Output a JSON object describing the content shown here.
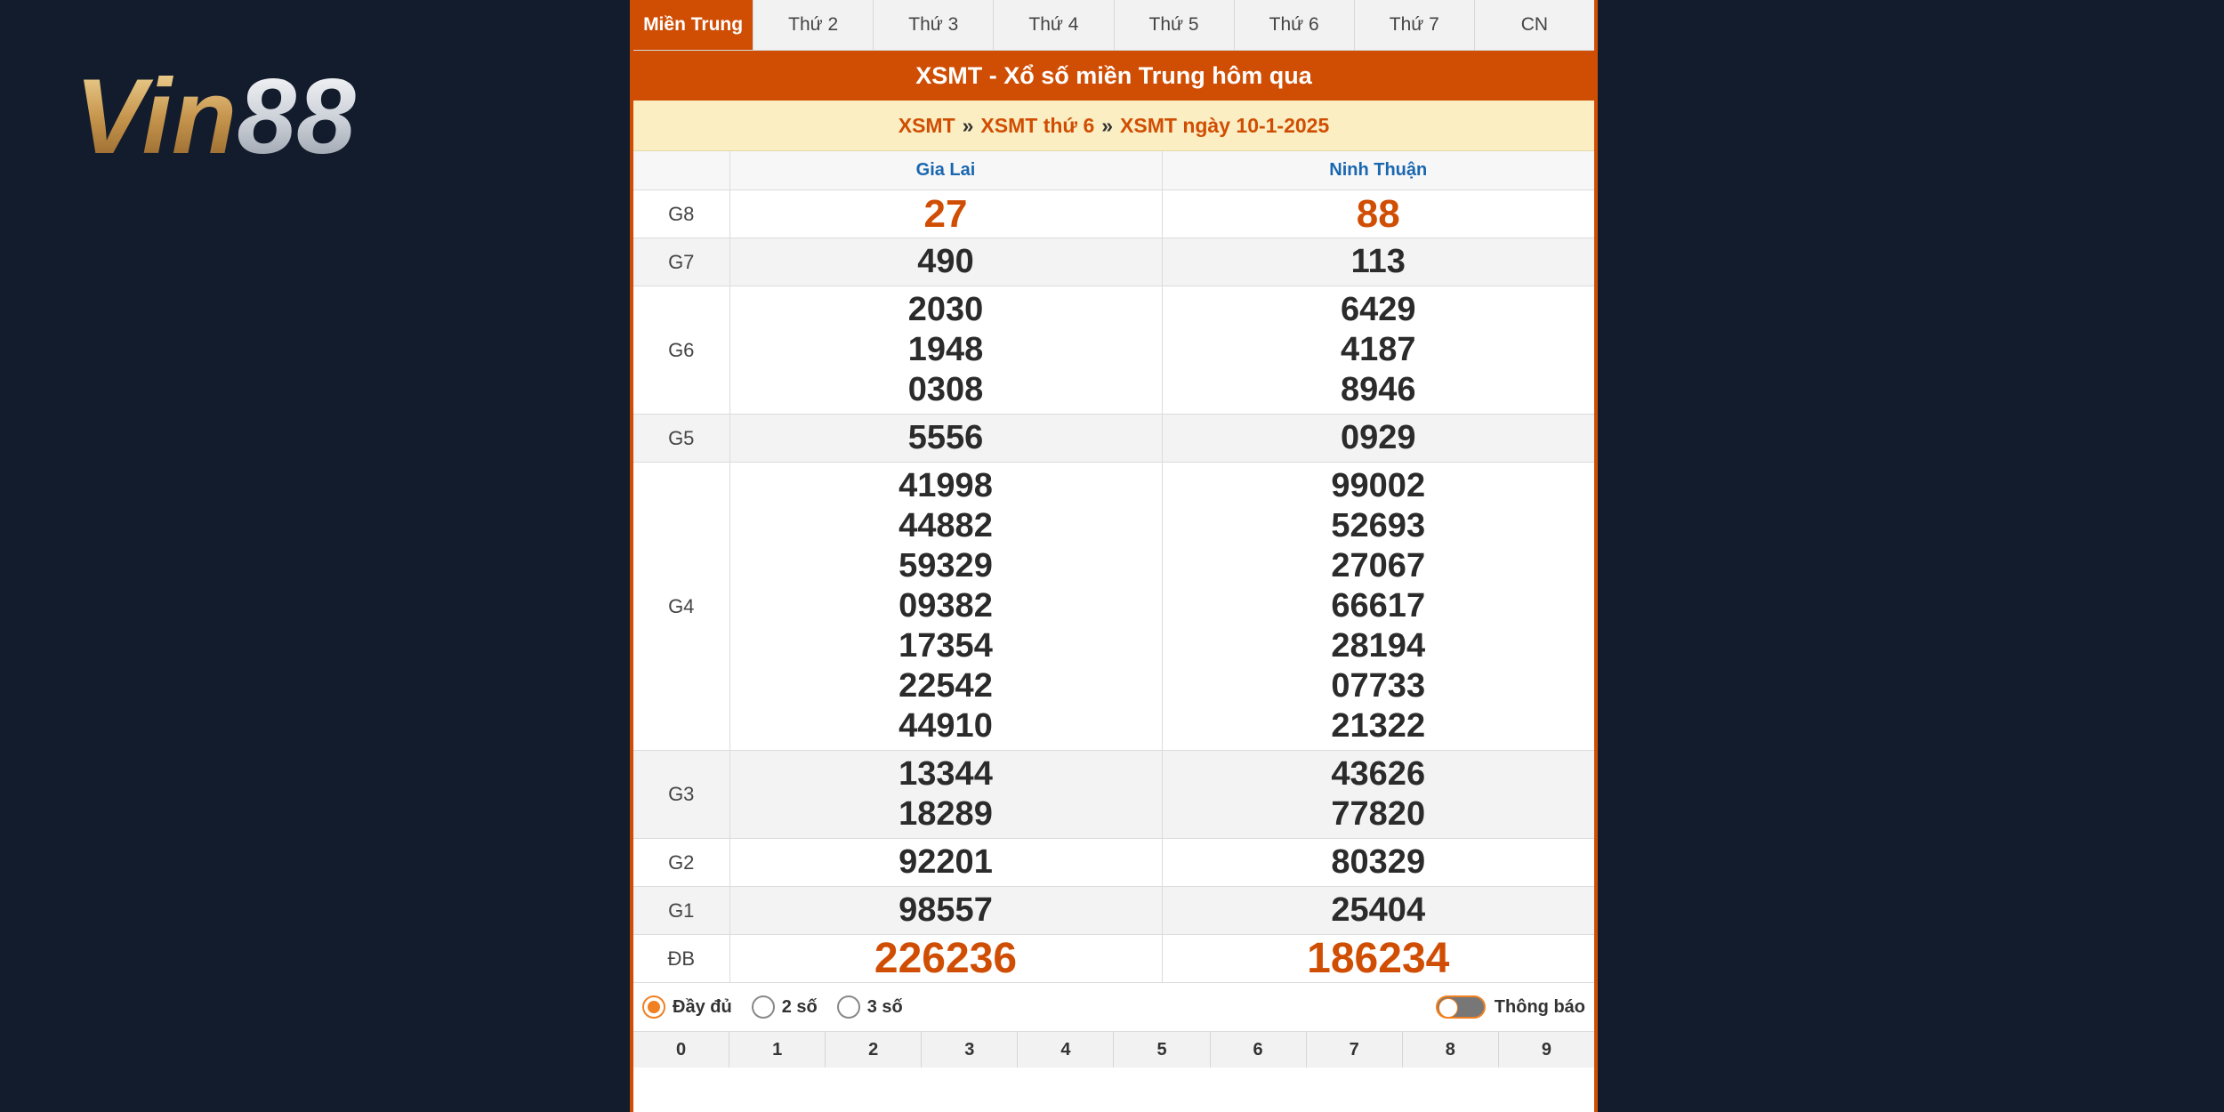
{
  "logo": {
    "text": "Vin88",
    "main": "Vin",
    "accent": "88"
  },
  "tabs": [
    {
      "label": "Miền Trung",
      "active": true
    },
    {
      "label": "Thứ 2"
    },
    {
      "label": "Thứ 3"
    },
    {
      "label": "Thứ 4"
    },
    {
      "label": "Thứ 5"
    },
    {
      "label": "Thứ 6"
    },
    {
      "label": "Thứ 7"
    },
    {
      "label": "CN"
    }
  ],
  "title": "XSMT - Xổ số miền Trung hôm qua",
  "breadcrumb": {
    "items": [
      "XSMT",
      "XSMT thứ 6",
      "XSMT ngày 10-1-2025"
    ],
    "separator": "»"
  },
  "provinces": [
    "Gia Lai",
    "Ninh Thuận"
  ],
  "prizes": [
    {
      "label": "G8",
      "values": [
        [
          "27"
        ],
        [
          "88"
        ]
      ],
      "style": "special"
    },
    {
      "label": "G7",
      "values": [
        [
          "490"
        ],
        [
          "113"
        ]
      ]
    },
    {
      "label": "G6",
      "values": [
        [
          "2030",
          "1948",
          "0308"
        ],
        [
          "6429",
          "4187",
          "8946"
        ]
      ]
    },
    {
      "label": "G5",
      "values": [
        [
          "5556"
        ],
        [
          "0929"
        ]
      ]
    },
    {
      "label": "G4",
      "values": [
        [
          "41998",
          "44882",
          "59329",
          "09382",
          "17354",
          "22542",
          "44910"
        ],
        [
          "99002",
          "52693",
          "27067",
          "66617",
          "28194",
          "07733",
          "21322"
        ]
      ]
    },
    {
      "label": "G3",
      "values": [
        [
          "13344",
          "18289"
        ],
        [
          "43626",
          "77820"
        ]
      ]
    },
    {
      "label": "G2",
      "values": [
        [
          "92201"
        ],
        [
          "80329"
        ]
      ]
    },
    {
      "label": "G1",
      "values": [
        [
          "98557"
        ],
        [
          "25404"
        ]
      ]
    },
    {
      "label": "ĐB",
      "values": [
        [
          "226236"
        ],
        [
          "186234"
        ]
      ],
      "style": "big"
    }
  ],
  "options": {
    "radios": [
      {
        "label": "Đầy đủ",
        "checked": true
      },
      {
        "label": "2 số",
        "checked": false
      },
      {
        "label": "3 số",
        "checked": false
      }
    ],
    "toggle_label": "Thông báo"
  },
  "digits": [
    "0",
    "1",
    "2",
    "3",
    "4",
    "5",
    "6",
    "7",
    "8",
    "9"
  ],
  "colors": {
    "accent": "#d04e04",
    "link": "#1a67b0",
    "background": "#131c2c"
  }
}
